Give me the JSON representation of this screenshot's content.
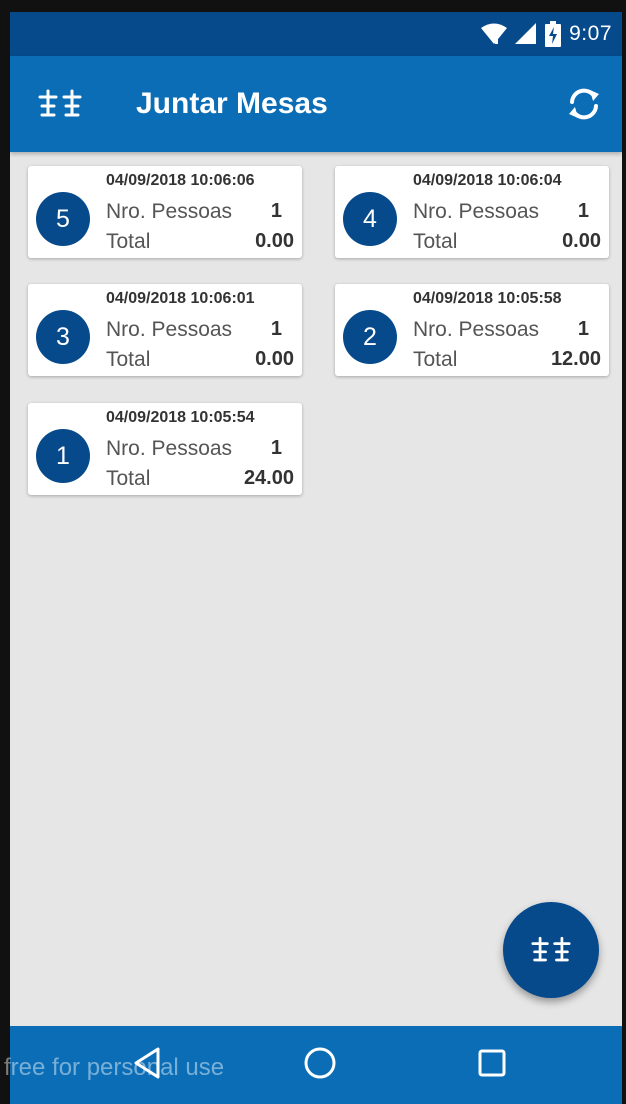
{
  "status_bar": {
    "time": "9:07",
    "icons": [
      "wifi-icon",
      "signal-icon",
      "battery-charging-icon"
    ]
  },
  "app_bar": {
    "title": "Juntar Mesas",
    "left_icon": "tables-icon",
    "right_icon": "refresh-icon"
  },
  "tables": [
    {
      "number": "5",
      "datetime": "04/09/2018 10:06:06",
      "people_label": "Nro. Pessoas",
      "people": "1",
      "total_label": "Total",
      "total": "0.00"
    },
    {
      "number": "4",
      "datetime": "04/09/2018 10:06:04",
      "people_label": "Nro. Pessoas",
      "people": "1",
      "total_label": "Total",
      "total": "0.00"
    },
    {
      "number": "3",
      "datetime": "04/09/2018 10:06:01",
      "people_label": "Nro. Pessoas",
      "people": "1",
      "total_label": "Total",
      "total": "0.00"
    },
    {
      "number": "2",
      "datetime": "04/09/2018 10:05:58",
      "people_label": "Nro. Pessoas",
      "people": "1",
      "total_label": "Total",
      "total": "12.00"
    },
    {
      "number": "1",
      "datetime": "04/09/2018 10:05:54",
      "people_label": "Nro. Pessoas",
      "people": "1",
      "total_label": "Total",
      "total": "24.00"
    }
  ],
  "fab": {
    "icon": "tables-icon"
  },
  "nav_bar": {
    "icons": [
      "back-icon",
      "home-icon",
      "recents-icon"
    ]
  },
  "watermark": "free for personal use",
  "colors": {
    "status_bar": "#064a8c",
    "app_bar": "#0a6db6",
    "accent_dark": "#064a8c",
    "background": "#e6e6e6"
  }
}
